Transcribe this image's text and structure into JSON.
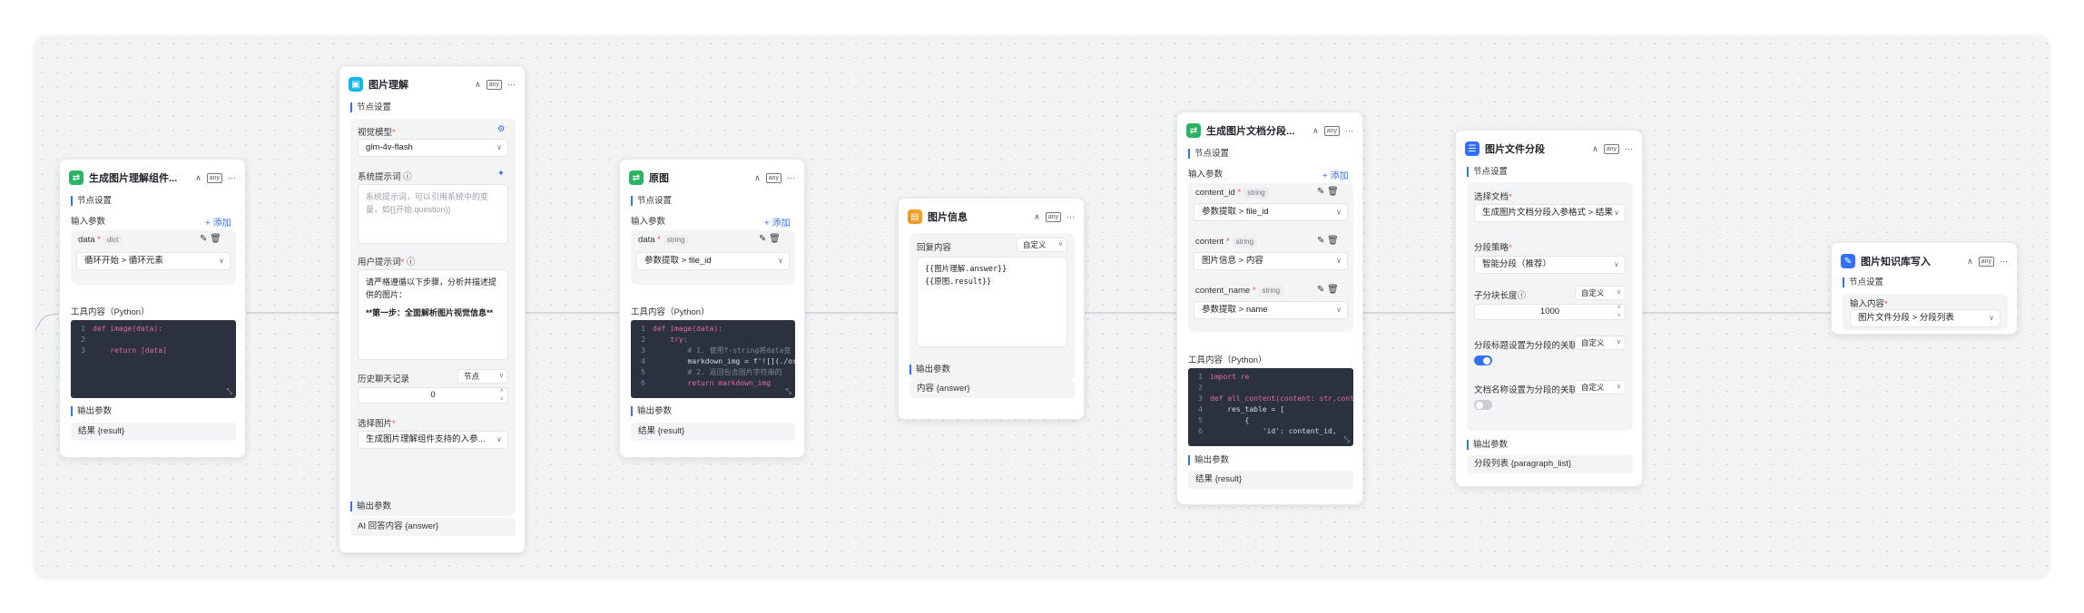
{
  "common": {
    "node_settings": "节点设置",
    "input_params": "输入参数",
    "output_params": "输出参数",
    "tool_content": "工具内容（Python）",
    "add": "+ 添加",
    "any": "any",
    "collapse": "∧",
    "more": "···",
    "string": "string",
    "dict": "dict",
    "required_mark": "*"
  },
  "node1": {
    "title": "生成图片理解组件...",
    "param_name": "data",
    "param_value": "循环开始 > 循环元素",
    "code": [
      {
        "n": "1",
        "t": "def image(data):"
      },
      {
        "n": "2",
        "t": ""
      },
      {
        "n": "3",
        "t": "    return [data]"
      }
    ],
    "output": "结果 {result}"
  },
  "node2": {
    "title": "图片理解",
    "model_label": "视觉模型",
    "model_value": "glm-4v-flash",
    "system_label": "系统提示词",
    "system_placeholder": "系统提示词，可以引用系统中的变量，如{{开始.question}}",
    "user_label": "用户提示词",
    "user_text_1": "请严格遵循以下步骤，分析并描述提供的图片：",
    "user_text_2": "**第一步：全面解析图片视觉信息**",
    "history_label": "历史聊天记录",
    "history_mode": "节点",
    "history_value": "0",
    "image_label": "选择图片",
    "image_value": "生成图片理解组件支持的入参...",
    "output": "AI 回答内容 {answer}"
  },
  "node3": {
    "title": "原图",
    "param_name": "data",
    "param_value": "参数提取 > file_id",
    "code": [
      {
        "n": "1",
        "t": "def image(data):"
      },
      {
        "n": "2",
        "t": "    try:"
      },
      {
        "n": "3",
        "t": "        # 1. 使用f-string将data变"
      },
      {
        "n": "4",
        "t": "        markdown_img = f'![](./oss"
      },
      {
        "n": "5",
        "t": "        # 2. 返回包含图片字符串的"
      },
      {
        "n": "6",
        "t": "        return markdown_img"
      }
    ],
    "output": "结果 {result}"
  },
  "node4": {
    "title": "图片信息",
    "content_label": "回复内容",
    "mode": "自定义",
    "lines": [
      "{{图片理解.answer}}",
      "{{原图.result}}"
    ],
    "output": "内容 {answer}"
  },
  "node5": {
    "title": "生成图片文档分段...",
    "params": [
      {
        "name": "content_id",
        "value": "参数提取 > file_id"
      },
      {
        "name": "content",
        "value": "图片信息 > 内容"
      },
      {
        "name": "content_name",
        "value": "参数提取 > name"
      }
    ],
    "code": [
      {
        "n": "1",
        "t": "import re"
      },
      {
        "n": "2",
        "t": ""
      },
      {
        "n": "3",
        "t": "def all_content(content: str,cont"
      },
      {
        "n": "4",
        "t": "    res_table = ["
      },
      {
        "n": "5",
        "t": "        {"
      },
      {
        "n": "6",
        "t": "            'id': content_id,"
      }
    ],
    "output": "结果 {result}"
  },
  "node6": {
    "title": "图片文件分段",
    "doc_label": "选择文档",
    "doc_value": "生成图片文档分段入参格式 > 结果",
    "strategy_label": "分段策略",
    "strategy_value": "智能分段（推荐）",
    "chunk_label": "子分块长度",
    "chunk_mode": "自定义",
    "chunk_value": "1000",
    "title_assoc_label": "分段标题设置为分段的关联问题",
    "title_assoc_mode": "自定义",
    "title_assoc_on": true,
    "name_assoc_label": "文档名称设置为分段的关联问题",
    "name_assoc_mode": "自定义",
    "name_assoc_on": false,
    "output": "分段列表 {paragraph_list}"
  },
  "node7": {
    "title": "图片知识库写入",
    "content_label": "输入内容",
    "content_value": "图片文件分段 > 分段列表"
  },
  "colors": {
    "green": "#28b463",
    "blue": "#2c8cf4",
    "orange": "#f59a23",
    "indigo": "#3370ff",
    "cyan": "#14b8e6",
    "accent": "#3370ff"
  }
}
